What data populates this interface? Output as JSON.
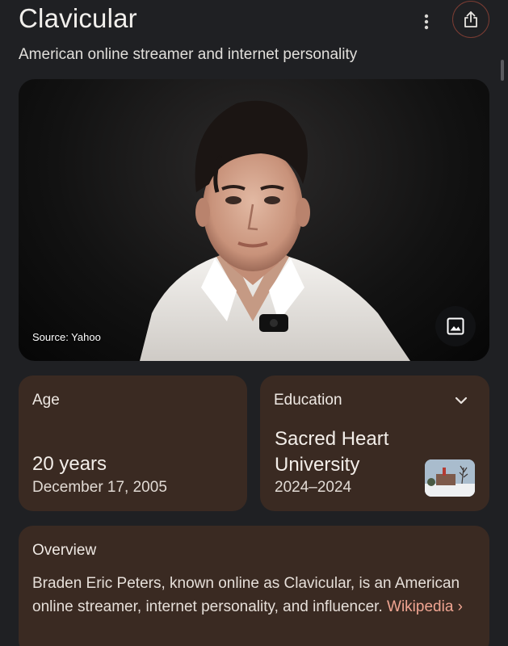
{
  "header": {
    "title": "Clavicular",
    "subtitle": "American online streamer and internet personality"
  },
  "photo": {
    "source_label": "Source: Yahoo"
  },
  "age_card": {
    "label": "Age",
    "value": "20 years",
    "date": "December 17, 2005"
  },
  "education_card": {
    "label": "Education",
    "school": "Sacred Heart University",
    "years": "2024–2024"
  },
  "overview_card": {
    "label": "Overview",
    "text": "Braden Eric Peters, known online as Clavicular, is an American online streamer, internet personality, and influencer.",
    "link_label": "Wikipedia",
    "link_chevron": "›"
  },
  "icons": {
    "more": "more-vert-icon",
    "share": "share-icon",
    "image": "image-icon",
    "expand": "chevron-down-icon"
  },
  "colors": {
    "background": "#1f2023",
    "card": "#3a2a22",
    "link": "#f0a592",
    "share_ring": "#7a3c33"
  }
}
